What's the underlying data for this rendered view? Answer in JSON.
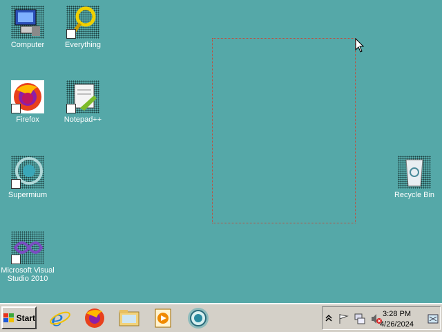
{
  "desktop": {
    "icons": [
      {
        "label": "Computer"
      },
      {
        "label": "Everything"
      },
      {
        "label": "Firefox"
      },
      {
        "label": "Notepad++"
      },
      {
        "label": "Supermium"
      },
      {
        "label": "Microsoft Visual Studio 2010"
      },
      {
        "label": "Recycle Bin"
      }
    ]
  },
  "taskbar": {
    "start_label": "Start",
    "pinned": [
      "internet-explorer-icon",
      "firefox-icon",
      "file-explorer-icon",
      "media-player-icon",
      "supermium-icon"
    ],
    "clock": {
      "time": "3:28 PM",
      "date": "4/26/2024"
    }
  },
  "colors": {
    "desktop": "#55a8a8",
    "taskbar": "#d4d0c8",
    "selection": "#c24a3a"
  }
}
